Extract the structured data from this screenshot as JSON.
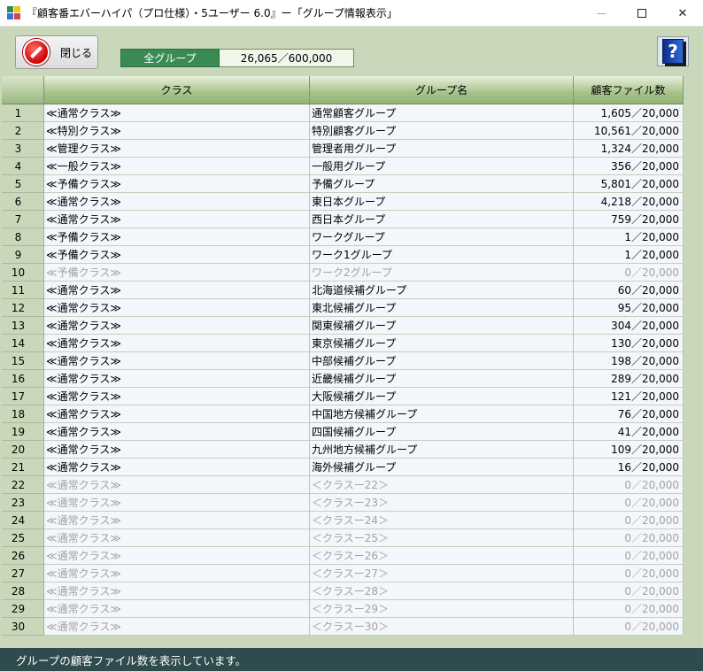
{
  "window": {
    "title": "『顧客番エバーハイパ（プロ仕様）・5ユーザー 6.0』ー「グループ情報表示」",
    "minimize_glyph": "—",
    "close_glyph": "✕"
  },
  "toolbar": {
    "close_label": "閉じる",
    "group_total_label": "全グループ",
    "group_total_value": "26,065／600,000",
    "help_glyph": "?"
  },
  "table": {
    "headers": {
      "index": "",
      "class": "クラス",
      "group": "グループ名",
      "count": "顧客ファイル数"
    },
    "rows": [
      {
        "no": "1",
        "cls": "≪通常クラス≫",
        "grp": "通常顧客グループ",
        "cnt": "1,605／20,000",
        "dim": false
      },
      {
        "no": "2",
        "cls": "≪特別クラス≫",
        "grp": "特別顧客グループ",
        "cnt": "10,561／20,000",
        "dim": false
      },
      {
        "no": "3",
        "cls": "≪管理クラス≫",
        "grp": "管理者用グループ",
        "cnt": "1,324／20,000",
        "dim": false
      },
      {
        "no": "4",
        "cls": "≪一般クラス≫",
        "grp": "一般用グループ",
        "cnt": "356／20,000",
        "dim": false
      },
      {
        "no": "5",
        "cls": "≪予備クラス≫",
        "grp": "予備グループ",
        "cnt": "5,801／20,000",
        "dim": false
      },
      {
        "no": "6",
        "cls": "≪通常クラス≫",
        "grp": "東日本グループ",
        "cnt": "4,218／20,000",
        "dim": false
      },
      {
        "no": "7",
        "cls": "≪通常クラス≫",
        "grp": "西日本グループ",
        "cnt": "759／20,000",
        "dim": false
      },
      {
        "no": "8",
        "cls": "≪予備クラス≫",
        "grp": "ワークグループ",
        "cnt": "1／20,000",
        "dim": false
      },
      {
        "no": "9",
        "cls": "≪予備クラス≫",
        "grp": "ワーク1グループ",
        "cnt": "1／20,000",
        "dim": false
      },
      {
        "no": "10",
        "cls": "≪予備クラス≫",
        "grp": "ワーク2グループ",
        "cnt": "0／20,000",
        "dim": true
      },
      {
        "no": "11",
        "cls": "≪通常クラス≫",
        "grp": "北海道候補グループ",
        "cnt": "60／20,000",
        "dim": false
      },
      {
        "no": "12",
        "cls": "≪通常クラス≫",
        "grp": "東北候補グループ",
        "cnt": "95／20,000",
        "dim": false
      },
      {
        "no": "13",
        "cls": "≪通常クラス≫",
        "grp": "関東候補グループ",
        "cnt": "304／20,000",
        "dim": false
      },
      {
        "no": "14",
        "cls": "≪通常クラス≫",
        "grp": "東京候補グループ",
        "cnt": "130／20,000",
        "dim": false
      },
      {
        "no": "15",
        "cls": "≪通常クラス≫",
        "grp": "中部候補グループ",
        "cnt": "198／20,000",
        "dim": false
      },
      {
        "no": "16",
        "cls": "≪通常クラス≫",
        "grp": "近畿候補グループ",
        "cnt": "289／20,000",
        "dim": false
      },
      {
        "no": "17",
        "cls": "≪通常クラス≫",
        "grp": "大阪候補グループ",
        "cnt": "121／20,000",
        "dim": false
      },
      {
        "no": "18",
        "cls": "≪通常クラス≫",
        "grp": "中国地方候補グループ",
        "cnt": "76／20,000",
        "dim": false
      },
      {
        "no": "19",
        "cls": "≪通常クラス≫",
        "grp": "四国候補グループ",
        "cnt": "41／20,000",
        "dim": false
      },
      {
        "no": "20",
        "cls": "≪通常クラス≫",
        "grp": "九州地方候補グループ",
        "cnt": "109／20,000",
        "dim": false
      },
      {
        "no": "21",
        "cls": "≪通常クラス≫",
        "grp": "海外候補グループ",
        "cnt": "16／20,000",
        "dim": false
      },
      {
        "no": "22",
        "cls": "≪通常クラス≫",
        "grp": "＜クラスー22＞",
        "cnt": "0／20,000",
        "dim": true
      },
      {
        "no": "23",
        "cls": "≪通常クラス≫",
        "grp": "＜クラスー23＞",
        "cnt": "0／20,000",
        "dim": true
      },
      {
        "no": "24",
        "cls": "≪通常クラス≫",
        "grp": "＜クラスー24＞",
        "cnt": "0／20,000",
        "dim": true
      },
      {
        "no": "25",
        "cls": "≪通常クラス≫",
        "grp": "＜クラスー25＞",
        "cnt": "0／20,000",
        "dim": true
      },
      {
        "no": "26",
        "cls": "≪通常クラス≫",
        "grp": "＜クラスー26＞",
        "cnt": "0／20,000",
        "dim": true
      },
      {
        "no": "27",
        "cls": "≪通常クラス≫",
        "grp": "＜クラスー27＞",
        "cnt": "0／20,000",
        "dim": true
      },
      {
        "no": "28",
        "cls": "≪通常クラス≫",
        "grp": "＜クラスー28＞",
        "cnt": "0／20,000",
        "dim": true
      },
      {
        "no": "29",
        "cls": "≪通常クラス≫",
        "grp": "＜クラスー29＞",
        "cnt": "0／20,000",
        "dim": true
      },
      {
        "no": "30",
        "cls": "≪通常クラス≫",
        "grp": "＜クラスー30＞",
        "cnt": "0／20,000",
        "dim": true
      }
    ]
  },
  "status": {
    "message": "グループの顧客ファイル数を表示しています。"
  },
  "colors": {
    "client_bg": "#c9d8bb",
    "header_green": "#94b377",
    "group_label_bg": "#3a8b53",
    "status_bg": "#2f4b4d",
    "dim_text": "#a3a3a3"
  }
}
